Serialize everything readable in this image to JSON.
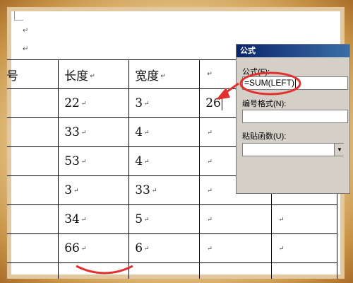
{
  "document": {
    "para_mark": "↵",
    "table": {
      "header": [
        "号",
        "长度",
        "宽度",
        "",
        ""
      ],
      "rows": [
        [
          "",
          "22",
          "3",
          "26",
          ""
        ],
        [
          "",
          "33",
          "4",
          "",
          ""
        ],
        [
          "",
          "53",
          "4",
          "",
          ""
        ],
        [
          "",
          "3",
          "33",
          "",
          ""
        ],
        [
          "",
          "34",
          "5",
          "",
          ""
        ],
        [
          "",
          "66",
          "6",
          "",
          ""
        ]
      ]
    }
  },
  "dialog": {
    "title": "公式",
    "formula_label": "公式(F):",
    "formula_value": "=SUM(LEFT)",
    "number_format_label": "编号格式(N):",
    "number_format_value": "",
    "paste_function_label": "粘贴函数(U):",
    "paste_function_value": ""
  },
  "colors": {
    "highlight_circle": "#e03030",
    "dialog_title_bar": "#0a246a",
    "frame": "#c99a4f"
  }
}
